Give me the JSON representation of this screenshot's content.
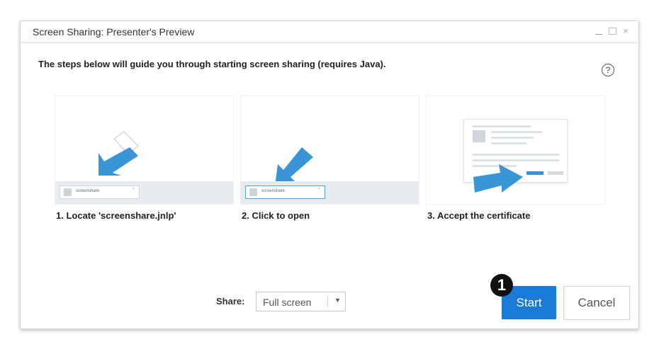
{
  "window": {
    "title": "Screen Sharing: Presenter's Preview",
    "controls": {
      "minimize": "minimize",
      "maximize": "maximize",
      "close": "×"
    }
  },
  "intro_text": "The steps below will guide you through starting screen sharing (requires Java).",
  "help_icon": "?",
  "steps": [
    {
      "label": "1. Locate 'screenshare.jnlp'",
      "file_name": "screenshare",
      "caret": "^"
    },
    {
      "label": "2. Click to open",
      "file_name": "screenshare",
      "caret": "^"
    },
    {
      "label": "3. Accept the certificate"
    }
  ],
  "share": {
    "label": "Share:",
    "selected": "Full screen",
    "caret": "▼"
  },
  "buttons": {
    "start": "Start",
    "cancel": "Cancel"
  },
  "annotation_marker": "1",
  "colors": {
    "primary": "#1a7ad8",
    "arrow": "#3a95d6",
    "card_bar": "#e8ecef"
  }
}
